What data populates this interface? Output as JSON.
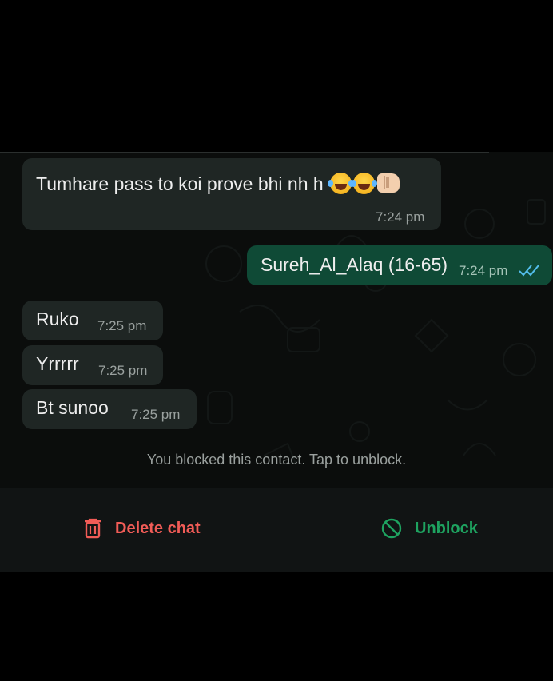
{
  "messages": [
    {
      "direction": "incoming",
      "text": "Tumhare pass to koi prove bhi nh h",
      "emojis": [
        "face-with-tears-of-joy-icon",
        "face-with-tears-of-joy-icon",
        "oncoming-fist-icon"
      ],
      "time": "7:24 pm"
    },
    {
      "direction": "outgoing",
      "text": "Sureh_Al_Alaq (16-65)",
      "time": "7:24 pm",
      "status": "read-double-tick-icon"
    },
    {
      "direction": "incoming",
      "text": "Ruko",
      "time": "7:25 pm"
    },
    {
      "direction": "incoming",
      "text": "Yrrrrr",
      "time": "7:25 pm"
    },
    {
      "direction": "incoming",
      "text": "Bt sunoo",
      "time": "7:25 pm"
    }
  ],
  "notice": "You blocked this contact. Tap to unblock.",
  "actions": {
    "delete_label": "Delete chat",
    "delete_icon": "trash-icon",
    "unblock_label": "Unblock",
    "unblock_icon": "block-circle-icon"
  },
  "colors": {
    "incoming_bubble": "#1f2624",
    "outgoing_bubble": "#0f4a36",
    "delete": "#f15c57",
    "unblock": "#1ea360",
    "read_tick": "#53bdeb"
  }
}
